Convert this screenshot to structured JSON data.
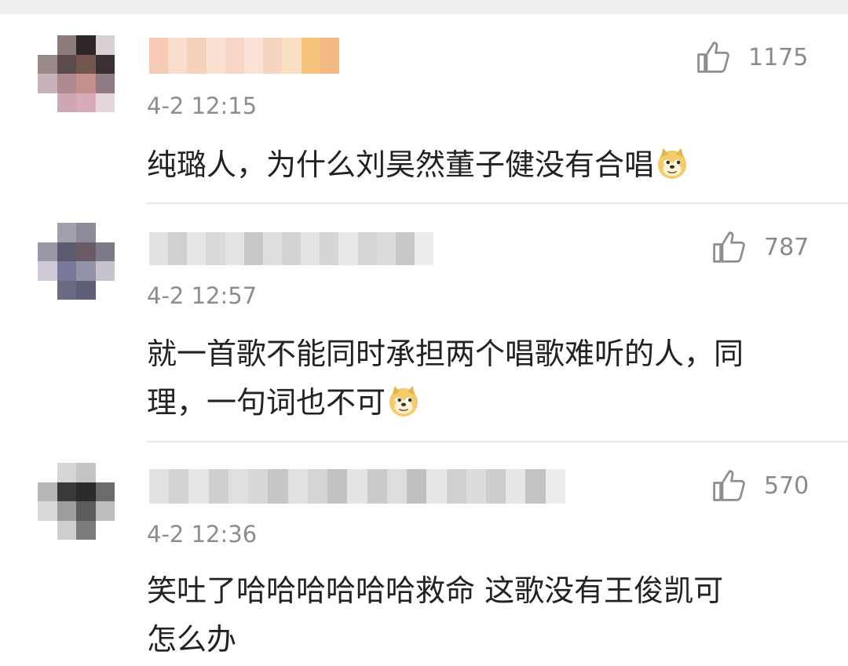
{
  "comments": [
    {
      "time": "4-2 12:15",
      "likes": "1175",
      "text": "纯璐人，为什么刘昊然董子健没有合唱",
      "emoji": "doge-emoji"
    },
    {
      "time": "4-2 12:57",
      "likes": "787",
      "text_line1": "就一首歌不能同时承担两个唱歌难听的人，同",
      "text_line2": "理，一句词也不可",
      "emoji": "doge-emoji"
    },
    {
      "time": "4-2 12:36",
      "likes": "570",
      "text_line1": "笑吐了哈哈哈哈哈哈救命 这歌没有王俊凯可",
      "text_line2": "怎么办"
    }
  ],
  "icons": {
    "like": "thumbs-up-icon",
    "avatar": "blurred-avatar"
  },
  "colors": {
    "text": "#222222",
    "meta": "#8d8d8d",
    "divider": "#e8e8e8"
  }
}
